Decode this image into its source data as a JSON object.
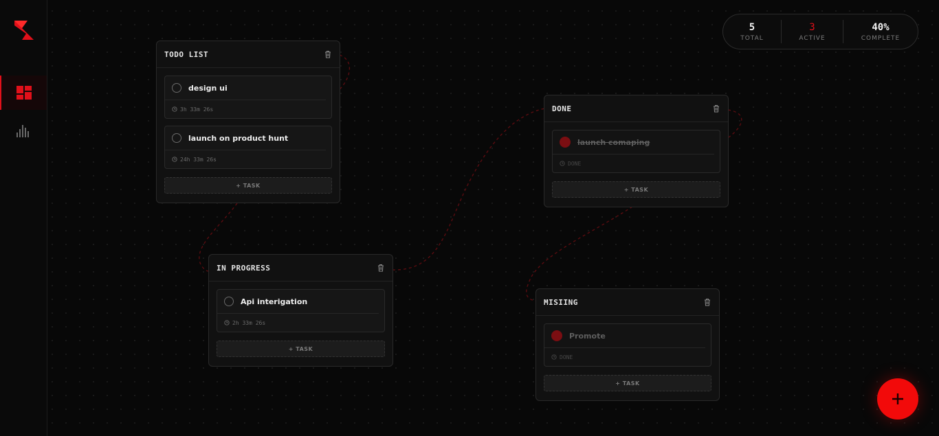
{
  "sidebar": {
    "logo_icon": "app-logo-icon",
    "items": [
      {
        "icon": "board-grid-icon",
        "active": true
      },
      {
        "icon": "bar-chart-icon",
        "active": false
      }
    ]
  },
  "stats": {
    "total": {
      "value": "5",
      "label": "TOTAL"
    },
    "active": {
      "value": "3",
      "label": "ACTIVE"
    },
    "complete": {
      "value": "40%",
      "label": "COMPLETE"
    }
  },
  "colors": {
    "accent": "#f20a0a",
    "background": "#080808",
    "card": "#111111"
  },
  "lists": [
    {
      "title": "TODO LIST",
      "add_label": "+ TASK",
      "tasks": [
        {
          "name": "design ui",
          "meta": "3h 33m 26s",
          "done": false
        },
        {
          "name": "launch on product hunt",
          "meta": "24h 33m 26s",
          "done": false
        }
      ]
    },
    {
      "title": "IN PROGRESS",
      "add_label": "+ TASK",
      "tasks": [
        {
          "name": "Api interigation",
          "meta": "2h 33m 26s",
          "done": false
        }
      ]
    },
    {
      "title": "DONE",
      "add_label": "+ TASK",
      "tasks": [
        {
          "name": "launch comaping",
          "meta": "DONE",
          "done": true
        }
      ]
    },
    {
      "title": "MISIING",
      "add_label": "+ TASK",
      "tasks": [
        {
          "name": "Promote",
          "meta": "DONE",
          "done": true
        }
      ]
    }
  ],
  "fab": {
    "label": "+"
  }
}
